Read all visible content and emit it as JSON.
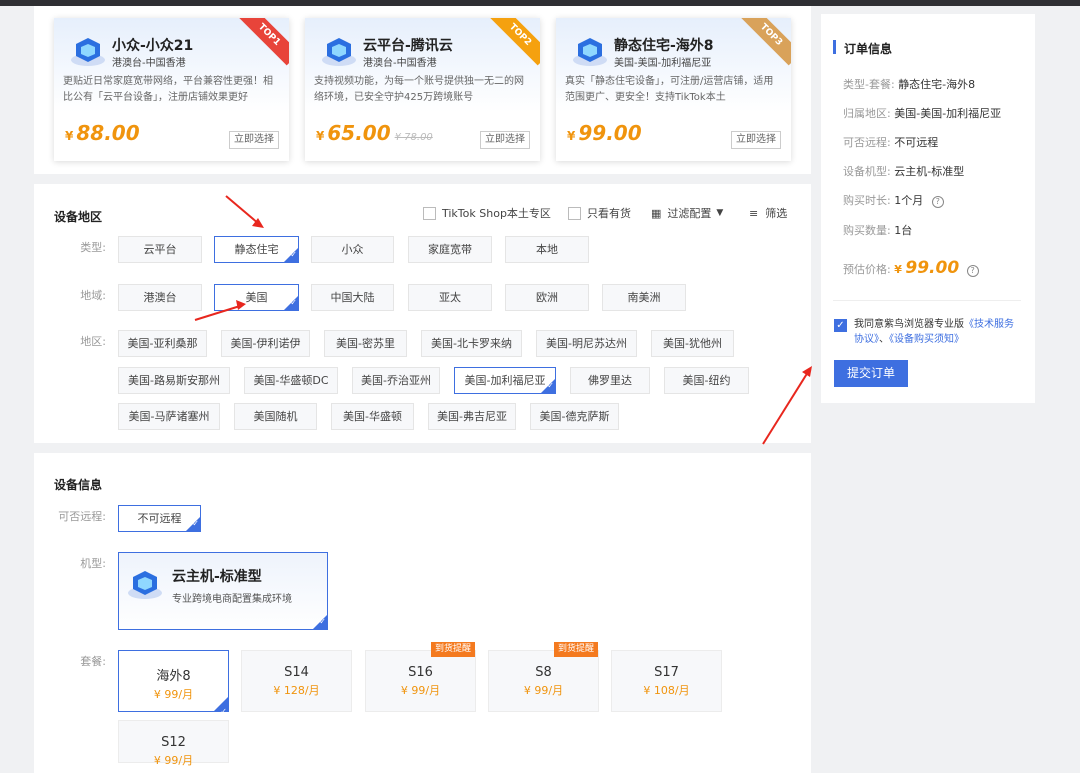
{
  "cards": [
    {
      "title": "小众-小众21",
      "sub": "港澳台-中国香港",
      "desc": "更贴近日常家庭宽带网络，平台兼容性更强！相比公有「云平台设备」，注册店铺效果更好",
      "currency": "¥",
      "price": "88.00",
      "old": "",
      "btn": "立即选择",
      "rank": "TOP1",
      "rank_color": "#e8443a"
    },
    {
      "title": "云平台-腾讯云",
      "sub": "港澳台-中国香港",
      "desc": "支持视频功能，为每一个账号提供独一无二的网络环境，已安全守护425万跨境账号",
      "currency": "¥",
      "price": "65.00",
      "old": "¥ 78.00",
      "btn": "立即选择",
      "rank": "TOP2",
      "rank_color": "#f5a10f"
    },
    {
      "title": "静态住宅-海外8",
      "sub": "美国-美国-加利福尼亚",
      "desc": "真实「静态住宅设备」，可注册/运营店铺，适用范围更广、更安全！支持TikTok本土",
      "currency": "¥",
      "price": "99.00",
      "old": "",
      "btn": "立即选择",
      "rank": "TOP3",
      "rank_color": "#d9a25a"
    }
  ],
  "region": {
    "title": "设备地区",
    "filters": {
      "tiktok": "TikTok Shop本土专区",
      "instock": "只看有货",
      "config": "过滤配置",
      "screen": "筛选"
    },
    "type_label": "类型:",
    "types": [
      "云平台",
      "静态住宅",
      "小众",
      "家庭宽带",
      "本地"
    ],
    "domain_label": "地域:",
    "domains": [
      "港澳台",
      "美国",
      "中国大陆",
      "亚太",
      "欧洲",
      "南美洲"
    ],
    "area_label": "地区:",
    "areas_row1": [
      "美国-亚利桑那",
      "美国-伊利诺伊",
      "美国-密苏里",
      "美国-北卡罗来纳",
      "美国-明尼苏达州",
      "美国-犹他州"
    ],
    "areas_row2": [
      "美国-路易斯安那州",
      "美国-华盛顿DC",
      "美国-乔治亚州",
      "美国-加利福尼亚",
      "佛罗里达",
      "美国-纽约"
    ],
    "areas_row3": [
      "美国-马萨诸塞州",
      "美国随机",
      "美国-华盛顿",
      "美国-弗吉尼亚",
      "美国-德克萨斯"
    ]
  },
  "device": {
    "title": "设备信息",
    "remote_label": "可否远程:",
    "remote_value": "不可远程",
    "model_label": "机型:",
    "model_name": "云主机-标准型",
    "model_desc": "专业跨境电商配置集成环境",
    "pkg_label": "套餐:",
    "packages": [
      {
        "name": "海外8",
        "price": "¥ 99/月",
        "tag": ""
      },
      {
        "name": "S14",
        "price": "¥ 128/月",
        "tag": ""
      },
      {
        "name": "S16",
        "price": "¥ 99/月",
        "tag": "到货提醒"
      },
      {
        "name": "S8",
        "price": "¥ 99/月",
        "tag": "到货提醒"
      },
      {
        "name": "S17",
        "price": "¥ 108/月",
        "tag": ""
      },
      {
        "name": "S12",
        "price": "¥ 99/月",
        "tag": ""
      }
    ]
  },
  "order": {
    "title": "订单信息",
    "rows": [
      {
        "k": "类型-套餐:",
        "v": "静态住宅-海外8"
      },
      {
        "k": "归属地区:",
        "v": "美国-美国-加利福尼亚"
      },
      {
        "k": "可否远程:",
        "v": "不可远程"
      },
      {
        "k": "设备机型:",
        "v": "云主机-标准型"
      },
      {
        "k": "购买时长:",
        "v": "1个月"
      },
      {
        "k": "购买数量:",
        "v": "1台"
      }
    ],
    "price_label": "预估价格:",
    "price_currency": "¥",
    "price": "99.00",
    "agree_prefix": "我同意紫鸟浏览器专业版",
    "agree_link1": "《技术服务协议》",
    "agree_sep": "、",
    "agree_link2": "《设备购买须知》",
    "submit": "提交订单"
  },
  "colors": {
    "accent": "#3e6fe0",
    "price": "#f0940d",
    "arrow": "#e8271e"
  }
}
